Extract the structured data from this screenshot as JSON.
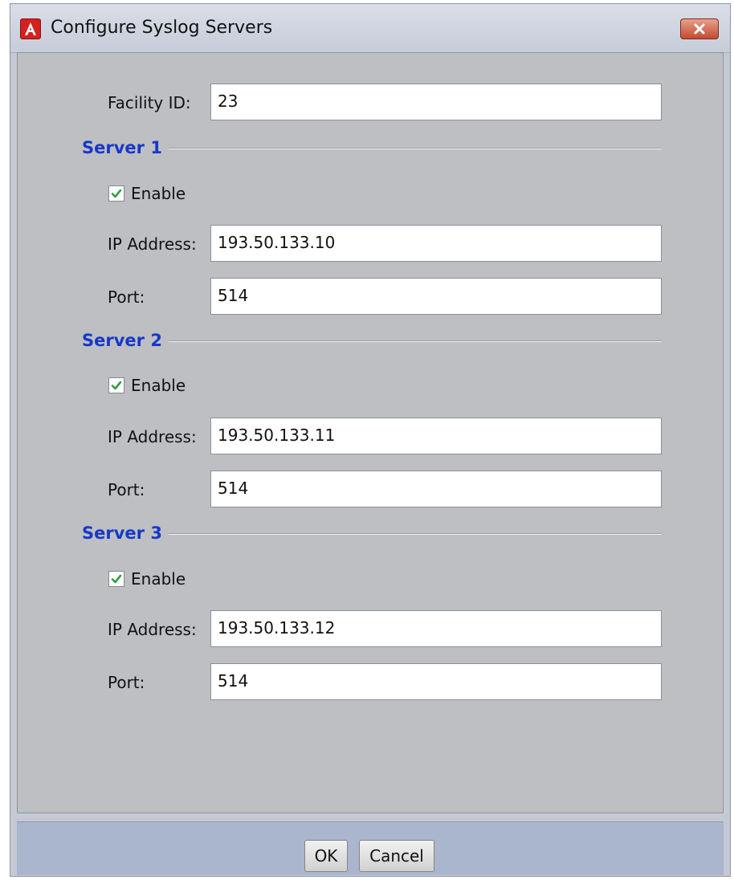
{
  "window": {
    "title": "Configure Syslog Servers",
    "app_icon": "app-logo-icon",
    "close_icon": "close-icon"
  },
  "facility": {
    "label": "Facility ID:",
    "value": "23"
  },
  "servers": [
    {
      "title": "Server 1",
      "enable_label": "Enable",
      "enabled": true,
      "ip_label": "IP Address:",
      "ip_value": "193.50.133.10",
      "port_label": "Port:",
      "port_value": "514"
    },
    {
      "title": "Server 2",
      "enable_label": "Enable",
      "enabled": true,
      "ip_label": "IP Address:",
      "ip_value": "193.50.133.11",
      "port_label": "Port:",
      "port_value": "514"
    },
    {
      "title": "Server 3",
      "enable_label": "Enable",
      "enabled": true,
      "ip_label": "IP Address:",
      "ip_value": "193.50.133.12",
      "port_label": "Port:",
      "port_value": "514"
    }
  ],
  "footer": {
    "ok_label": "OK",
    "cancel_label": "Cancel"
  },
  "colors": {
    "section_title": "#1738c8",
    "check_mark": "#2ea043",
    "app_icon": "#d42020",
    "close_button": "#c44a30"
  }
}
